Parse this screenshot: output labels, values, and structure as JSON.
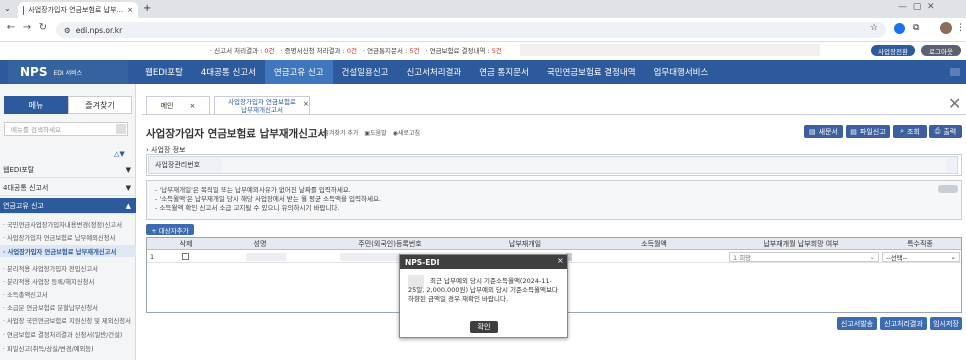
{
  "browser": {
    "tab_title": "사업장가입자 연금보험료 납부...",
    "url": "edi.nps.or.kr"
  },
  "notice": {
    "items": [
      {
        "label": "· 신고서 처리결과 : ",
        "value": "0건"
      },
      {
        "label": "· 증명서신청 처리결과 : ",
        "value": "0건"
      },
      {
        "label": "· 연금통지문서 : ",
        "value": "5건"
      },
      {
        "label": "· 연금보험료 결정내역 : ",
        "value": "5건"
      }
    ],
    "switch_btn": "사업장전환",
    "logout_btn": "로그아웃"
  },
  "site": {
    "logo": "NPS",
    "logo_sub": "EDI 서비스"
  },
  "gnb": [
    "웹EDI포탈",
    "4대공통 신고서",
    "연금고유 신고",
    "건설일용신고",
    "신고서처리결과",
    "연금 통지문서",
    "국민연금보험료 결정내역",
    "업무대행서비스"
  ],
  "lnb": {
    "tab_menu": "메뉴",
    "tab_fav": "즐겨찾기",
    "search_placeholder": "메뉴를 검색하세요",
    "sections": [
      "웹EDI포탈",
      "4대공통 신고서",
      "연금고유 신고"
    ],
    "subitems": [
      "· 국민연금사업장가입자내용변경(정정)신고서",
      "· 사업장가입자 연금보험료 납부예외신청서",
      "· 사업장가입자 연금보험료 납부재개신고서",
      "· 분리적용 사업장가입자 전입신고서",
      "· 분리적용 사업장 등록/해지신청서",
      "· 소득총액신고서",
      "· 소급분 연금보험료 분할납부신청서",
      "· 사업장 국민연금보험료 지원신청 및 제외신청서",
      "· 연금보험료 결정처리결과 신청서(일반/건설)",
      "· 파일신고(취득/상실/변경/예외등)"
    ]
  },
  "tabs": {
    "home": "메인",
    "current_line1": "사업장가입자 연금보험료",
    "current_line2": "납부재개신고서"
  },
  "page": {
    "title": "사업장가입자 연금보험료 납부재개신고서",
    "fav_add": "즐겨찾기 추가",
    "help": "도움말",
    "refresh": "새로고침",
    "section": "사업장 정보",
    "biz_label": "사업장관리번호",
    "buttons": [
      "새문서",
      "파일신고",
      "조회",
      "출력"
    ],
    "guides": [
      "- '납부재개일'은 복직일 또는 납부예외사유가 없어진 날짜를 입력하세요.",
      "- '소득월액'은 납부재개일 당시 해당 사업장에서 받는 월 평균 소득액을 입력하세요.",
      "- 소득월액 확인 신고서 소급 고지될 수 있으니 유의하시기 바랍니다."
    ],
    "add_target": "+ 대상자추가",
    "columns": [
      "삭제",
      "성명",
      "주민(외국인)등록번호",
      "납부재개일",
      "소득월액",
      "납부재개월 납부희망 여부",
      "특수직종"
    ],
    "row": {
      "num": "1",
      "pay_hope": "1 희망",
      "special": "--선택--"
    },
    "bottom_btns": [
      "신고서발송",
      "신고처리결과",
      "임시저장"
    ]
  },
  "modal": {
    "title": "NPS-EDI",
    "message": "최근 납부예외 당시 기준소득월액(2024-11-25일, 2,000,000원) 납부예외 당시 기준소득월액보다 하향된 금액일 경우 재확인 바랍니다.",
    "ok": "확인"
  }
}
